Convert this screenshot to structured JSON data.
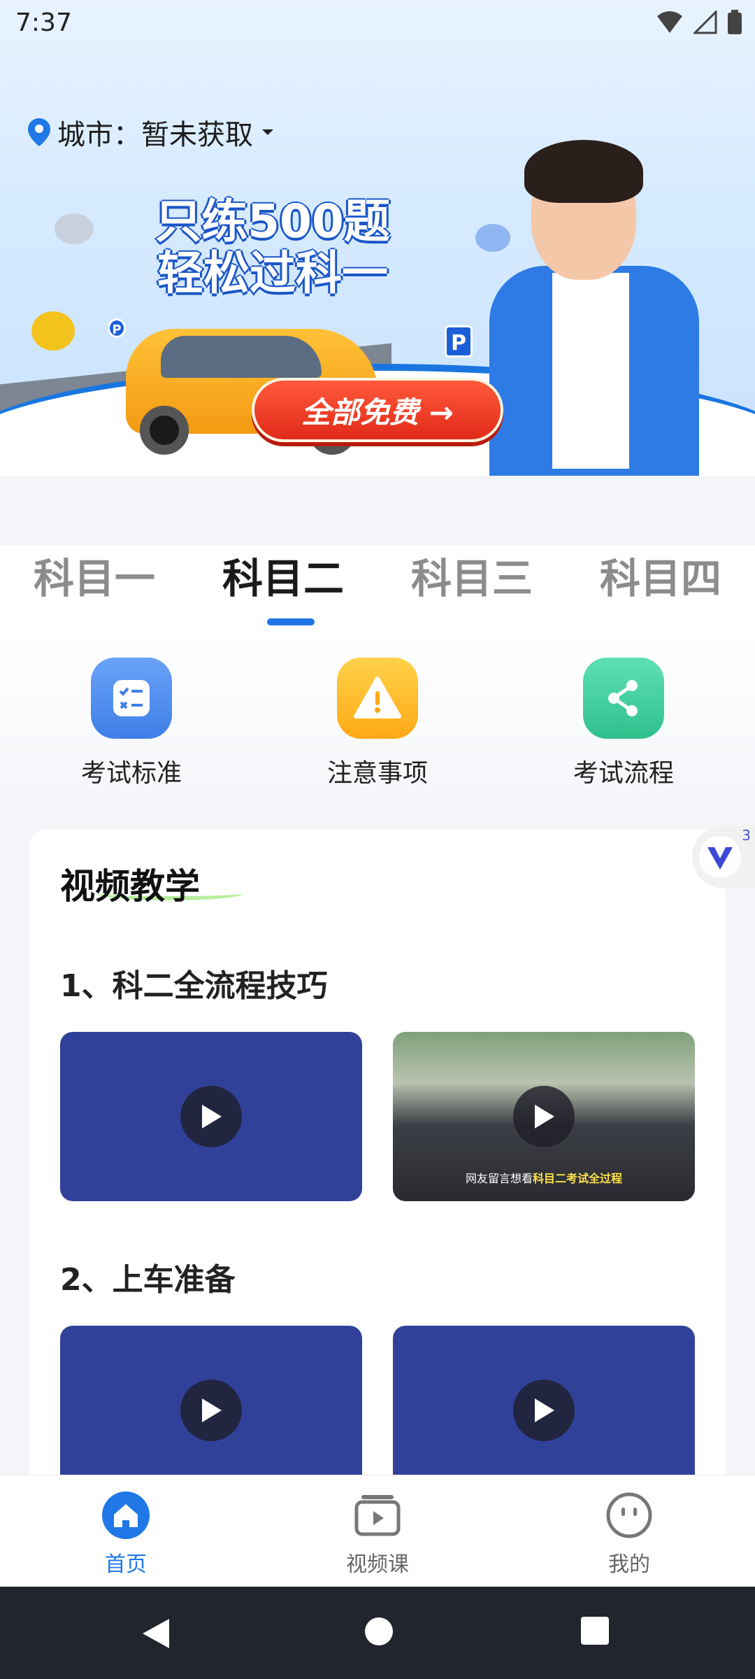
{
  "status_bar": {
    "time": "7:37"
  },
  "banner": {
    "city_label": "城市：暂未获取",
    "slogan_line1": "只练500题",
    "slogan_line2": "轻松过科一",
    "cta_label": "全部免费 →",
    "sign_p": "P"
  },
  "tabs": [
    {
      "label": "科目一",
      "active": false
    },
    {
      "label": "科目二",
      "active": true
    },
    {
      "label": "科目三",
      "active": false
    },
    {
      "label": "科目四",
      "active": false
    }
  ],
  "quick_actions": [
    {
      "label": "考试标准",
      "icon": "checklist-icon",
      "color": "#4f8ef2"
    },
    {
      "label": "注意事项",
      "icon": "warning-icon",
      "color": "#ffb21f"
    },
    {
      "label": "考试流程",
      "icon": "share-icon",
      "color": "#3ccf9a"
    }
  ],
  "floating_badge": {
    "count": "3"
  },
  "video_section": {
    "title": "视频教学",
    "groups": [
      {
        "title": "1、科二全流程技巧",
        "videos": [
          {
            "caption": ""
          },
          {
            "caption_prefix": "网友留言想看",
            "caption_highlight": "科目二考试全过程"
          }
        ]
      },
      {
        "title": "2、上车准备",
        "videos": [
          {
            "caption": ""
          },
          {
            "caption": ""
          }
        ]
      }
    ]
  },
  "bottom_nav": [
    {
      "label": "首页",
      "icon": "home-icon",
      "active": true
    },
    {
      "label": "视频课",
      "icon": "video-course-icon",
      "active": false
    },
    {
      "label": "我的",
      "icon": "profile-icon",
      "active": false
    }
  ],
  "colors": {
    "accent": "#1f78e6",
    "thumb_bg": "#31419a",
    "cta_red": "#e12a18"
  }
}
